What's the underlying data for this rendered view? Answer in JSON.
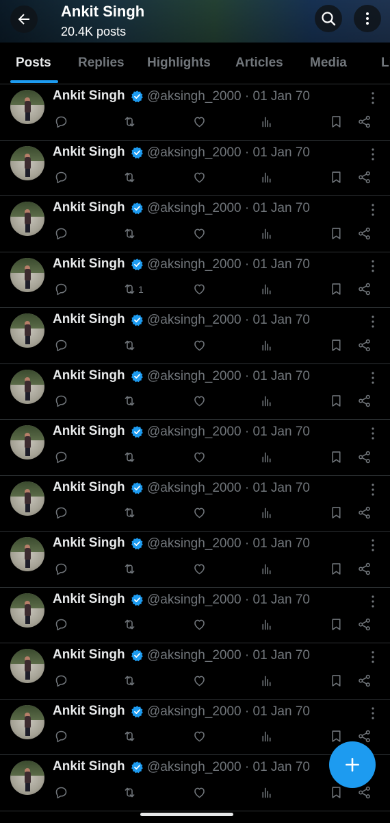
{
  "header": {
    "title": "Ankit Singh",
    "subtitle": "20.4K posts",
    "back_icon": "arrow-left-icon",
    "search_icon": "search-icon",
    "more_icon": "more-vertical-icon"
  },
  "tabs": [
    {
      "label": "Posts",
      "active": true
    },
    {
      "label": "Replies",
      "active": false
    },
    {
      "label": "Highlights",
      "active": false
    },
    {
      "label": "Articles",
      "active": false
    },
    {
      "label": "Media",
      "active": false
    },
    {
      "label": "Li",
      "active": false
    }
  ],
  "colors": {
    "accent": "#1d9bf0",
    "background": "#000000",
    "muted_text": "#71767b",
    "primary_text": "#e7e9ea",
    "divider": "#2f3336"
  },
  "posts": [
    {
      "name": "Ankit Singh",
      "handle": "@aksingh_2000 · 01 Jan 70",
      "repost_count": ""
    },
    {
      "name": "Ankit Singh",
      "handle": "@aksingh_2000 · 01 Jan 70",
      "repost_count": ""
    },
    {
      "name": "Ankit Singh",
      "handle": "@aksingh_2000 · 01 Jan 70",
      "repost_count": ""
    },
    {
      "name": "Ankit Singh",
      "handle": "@aksingh_2000 · 01 Jan 70",
      "repost_count": "1"
    },
    {
      "name": "Ankit Singh",
      "handle": "@aksingh_2000 · 01 Jan 70",
      "repost_count": ""
    },
    {
      "name": "Ankit Singh",
      "handle": "@aksingh_2000 · 01 Jan 70",
      "repost_count": ""
    },
    {
      "name": "Ankit Singh",
      "handle": "@aksingh_2000 · 01 Jan 70",
      "repost_count": ""
    },
    {
      "name": "Ankit Singh",
      "handle": "@aksingh_2000 · 01 Jan 70",
      "repost_count": ""
    },
    {
      "name": "Ankit Singh",
      "handle": "@aksingh_2000 · 01 Jan 70",
      "repost_count": ""
    },
    {
      "name": "Ankit Singh",
      "handle": "@aksingh_2000 · 01 Jan 70",
      "repost_count": ""
    },
    {
      "name": "Ankit Singh",
      "handle": "@aksingh_2000 · 01 Jan 70",
      "repost_count": ""
    },
    {
      "name": "Ankit Singh",
      "handle": "@aksingh_2000 · 01 Jan 70",
      "repost_count": ""
    },
    {
      "name": "Ankit Singh",
      "handle": "@aksingh_2000 · 01 Jan 70",
      "repost_count": ""
    }
  ],
  "fab": {
    "icon": "plus-icon"
  }
}
